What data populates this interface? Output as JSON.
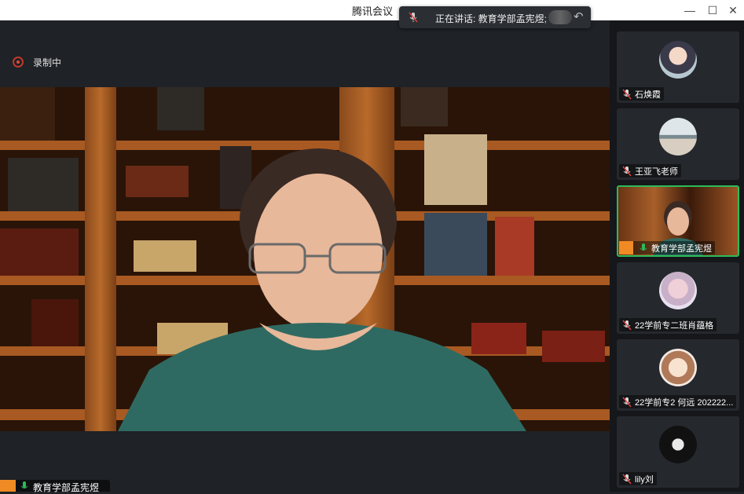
{
  "window": {
    "title": "腾讯会议",
    "minimize": "—",
    "maximize": "☐",
    "close": "✕"
  },
  "speaking": {
    "text": "正在讲话: 教育学部孟宪煜;"
  },
  "recording": {
    "label": "录制中"
  },
  "main_video": {
    "name": "教育学部孟宪煜"
  },
  "participants": [
    {
      "name": "石焕霞",
      "muted": true
    },
    {
      "name": "王亚飞老师",
      "muted": true
    },
    {
      "name": "教育学部孟宪煜",
      "muted": false,
      "active": true
    },
    {
      "name": "22学前专二班肖蕴格",
      "muted": true
    },
    {
      "name": "22学前专2 何远 202222...",
      "muted": true
    },
    {
      "name": "lily刘",
      "muted": true
    }
  ],
  "colors": {
    "accent": "#2dbb5a",
    "muted_mic": "#e8e8e8",
    "avatar": "#f08a24",
    "record": "#e74c3c"
  }
}
